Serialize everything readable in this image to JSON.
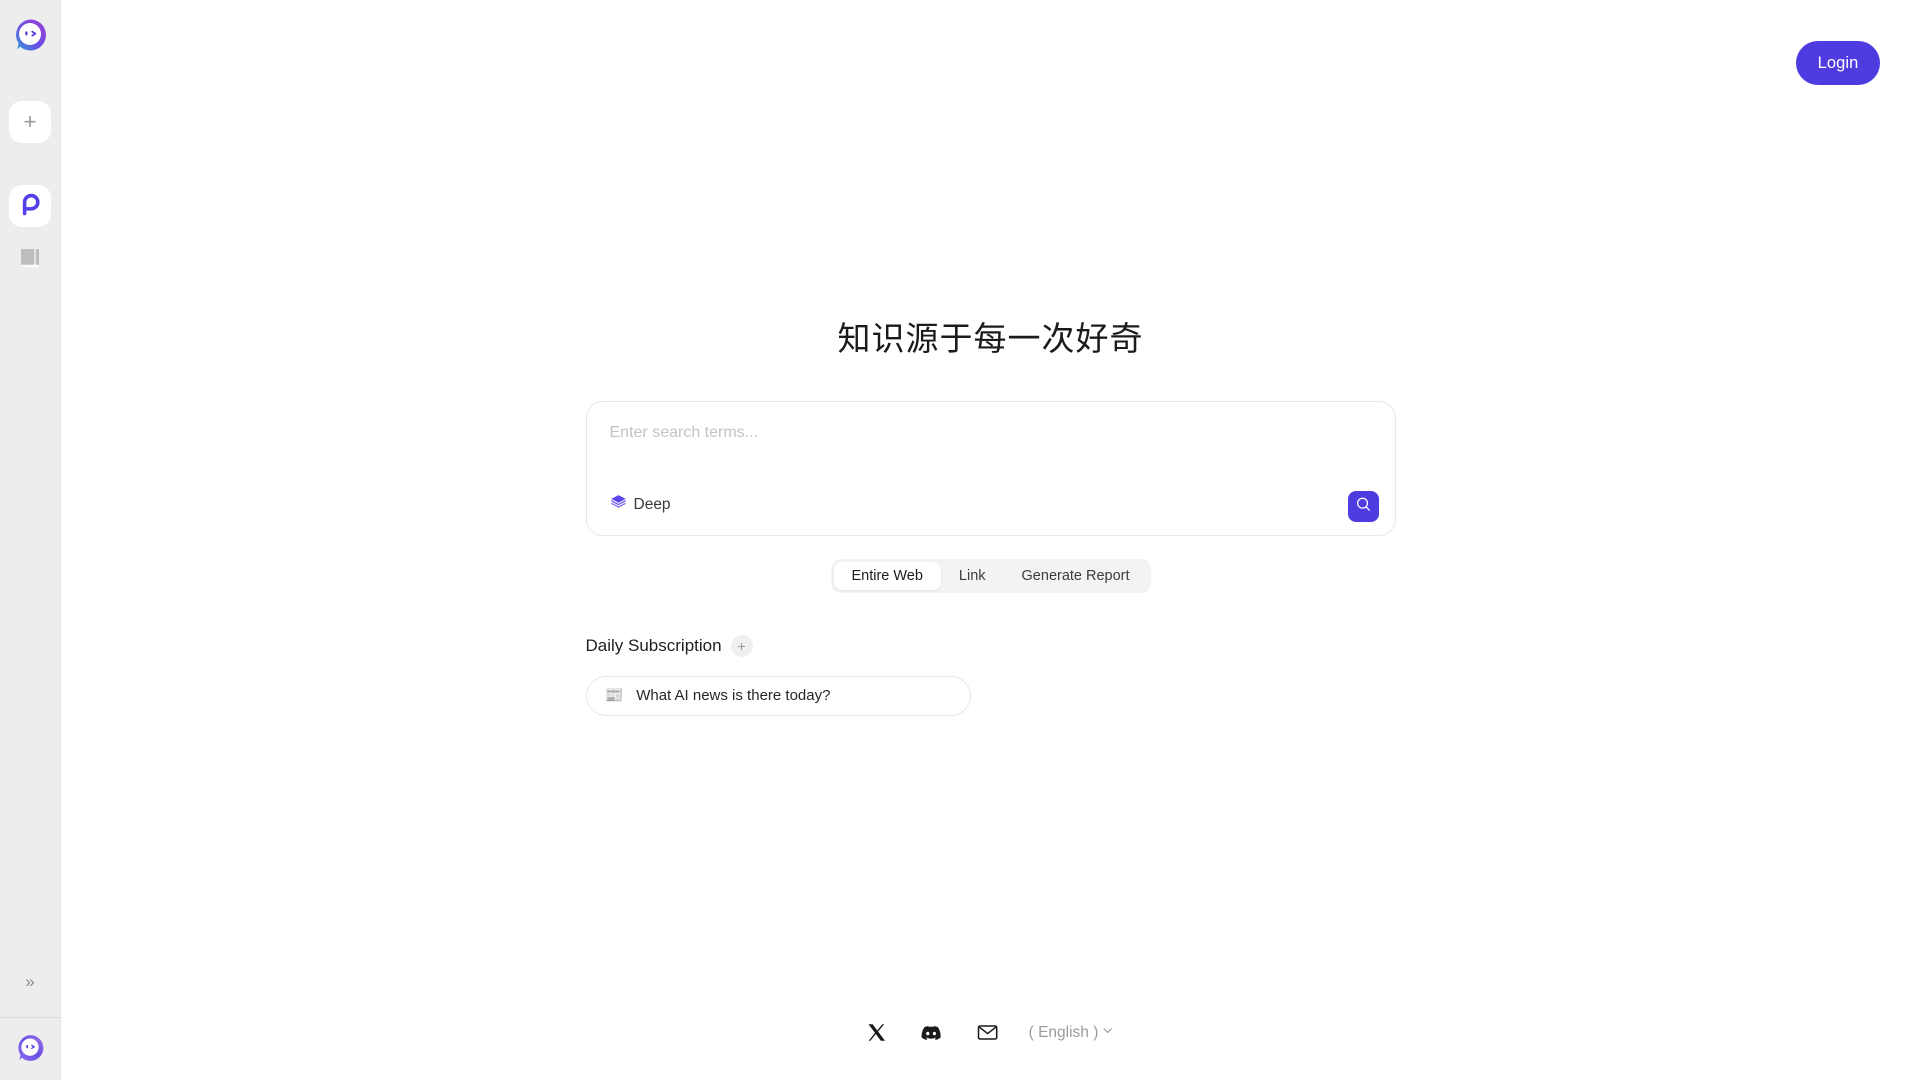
{
  "sidebar": {
    "logo_icon": "app-logo-icon",
    "items": [
      {
        "name": "new-chat",
        "icon": "plus-icon",
        "label": "+"
      },
      {
        "name": "app-switch",
        "icon": "p-logo-icon",
        "label": ""
      },
      {
        "name": "library",
        "icon": "book-icon",
        "label": ""
      }
    ],
    "expand_icon": "chevrons-right-icon",
    "expand_label": "»",
    "avatar_icon": "user-avatar-icon"
  },
  "header": {
    "login_label": "Login"
  },
  "main": {
    "title": "知识源于每一次好奇",
    "search": {
      "placeholder": "Enter search terms...",
      "value": "",
      "mode_label": "Deep",
      "mode_icon": "layers-icon",
      "submit_icon": "search-icon"
    },
    "tabs": [
      {
        "label": "Entire Web",
        "active": true
      },
      {
        "label": "Link",
        "active": false
      },
      {
        "label": "Generate Report",
        "active": false
      }
    ],
    "subscription": {
      "title": "Daily Subscription",
      "add_label": "+",
      "add_icon": "plus-icon",
      "cards": [
        {
          "icon": "newspaper-emoji",
          "glyph": "📰",
          "text": "What AI news is there today?"
        }
      ]
    }
  },
  "footer": {
    "social": [
      {
        "name": "x-twitter-icon",
        "label": "X"
      },
      {
        "name": "discord-icon",
        "label": "Discord"
      },
      {
        "name": "mail-icon",
        "label": "Mail"
      }
    ],
    "language": "( English )",
    "language_chevron_icon": "chevron-down-icon"
  },
  "colors": {
    "accent": "#4F3CE0",
    "sidebar_bg": "#EDEDED",
    "page_bg": "#FFFFFF",
    "muted_text": "#9B9B9B"
  }
}
